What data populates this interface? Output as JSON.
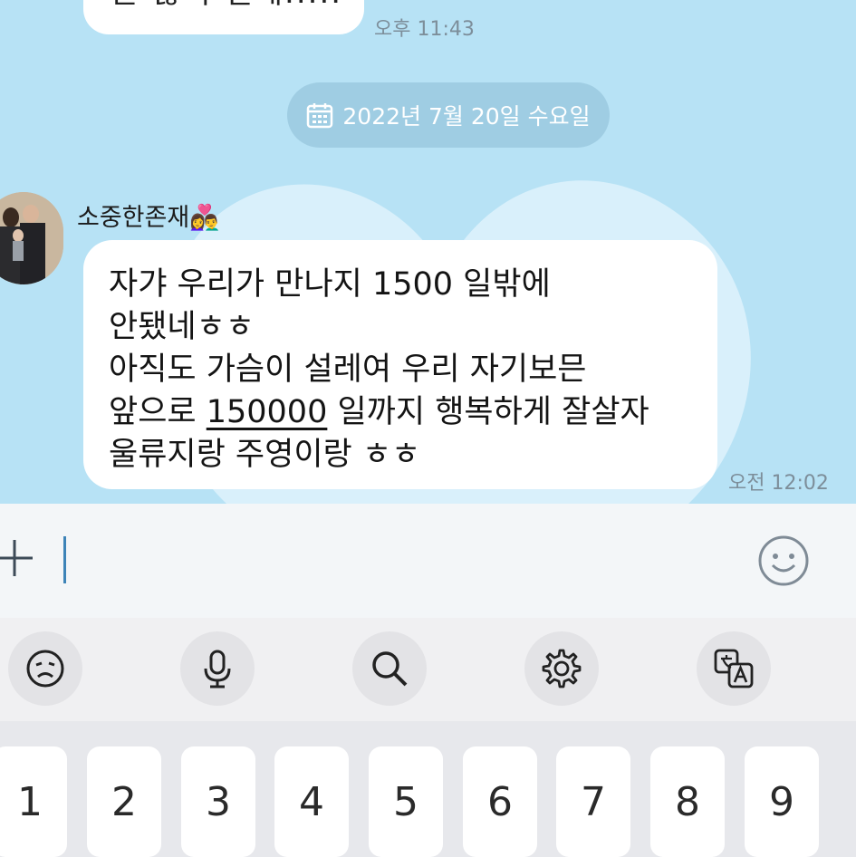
{
  "chat": {
    "prev_message_partial": "돈 많이 벌게.....",
    "prev_time": "오후 11:43",
    "date_divider": "2022년 7월 20일 수요일",
    "sender": "소중한존재👩‍❤️‍👨",
    "message_lines": [
      "자갸 우리가 만나지 1500 일밖에",
      "안됐네ㅎㅎ",
      "아직도 가슴이 설레여 우리 자기보믄"
    ],
    "line4_pre": "앞으로 ",
    "line4_underlined": "150000",
    "line4_post": " 일까지 행복하게 잘살자",
    "line5": "울류지랑 주영이랑 ㅎㅎ",
    "time": "오전 12:02"
  },
  "input": {
    "value": ""
  },
  "toolbar": {
    "icons": [
      "emoji-face-icon",
      "microphone-icon",
      "search-icon",
      "settings-gear-icon",
      "translate-icon"
    ]
  },
  "keyboard": {
    "number_row": [
      "1",
      "2",
      "3",
      "4",
      "5",
      "6",
      "7",
      "8",
      "9"
    ]
  },
  "colors": {
    "chat_bg": "#b7e2f5",
    "bubble": "#ffffff",
    "date_pill": "#9fcde3",
    "caret": "#3d84b8"
  }
}
